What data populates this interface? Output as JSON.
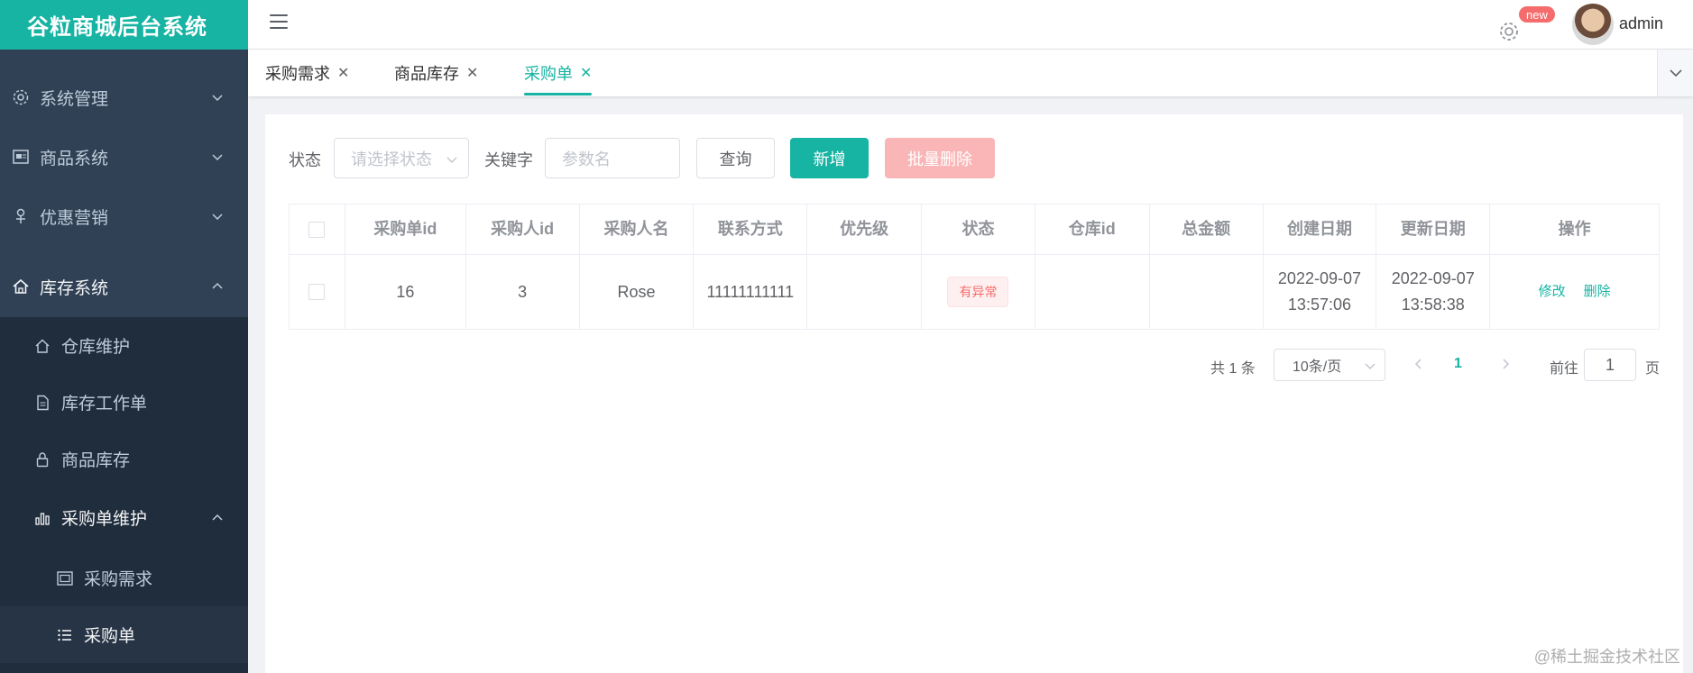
{
  "app": {
    "title": "谷粒商城后台系统"
  },
  "sidebar": {
    "items": [
      {
        "label": "系统管理",
        "icon": "gear-icon"
      },
      {
        "label": "商品系统",
        "icon": "goods-icon"
      },
      {
        "label": "优惠营销",
        "icon": "coupon-icon"
      },
      {
        "label": "库存系统",
        "icon": "home-icon"
      },
      {
        "label": "仓库维护",
        "icon": "house-icon"
      },
      {
        "label": "库存工作单",
        "icon": "document-icon"
      },
      {
        "label": "商品库存",
        "icon": "lock-icon"
      },
      {
        "label": "采购单维护",
        "icon": "bar-chart-icon"
      },
      {
        "label": "采购需求",
        "icon": "picture-icon"
      },
      {
        "label": "采购单",
        "icon": "list-icon"
      }
    ]
  },
  "header": {
    "badge": "new",
    "username": "admin"
  },
  "tabs": [
    {
      "label": "采购需求"
    },
    {
      "label": "商品库存"
    },
    {
      "label": "采购单"
    }
  ],
  "filters": {
    "status_label": "状态",
    "status_placeholder": "请选择状态",
    "keyword_label": "关键字",
    "keyword_placeholder": "参数名",
    "query_button": "查询",
    "add_button": "新增",
    "batch_delete_button": "批量删除"
  },
  "table": {
    "columns": [
      "采购单id",
      "采购人id",
      "采购人名",
      "联系方式",
      "优先级",
      "状态",
      "仓库id",
      "总金额",
      "创建日期",
      "更新日期",
      "操作"
    ],
    "rows": [
      {
        "id": "16",
        "assignee_id": "3",
        "assignee_name": "Rose",
        "phone": "11111111111",
        "priority": "",
        "status": "有异常",
        "ware_id": "",
        "amount": "",
        "create_date": "2022-09-07",
        "create_time": "13:57:06",
        "update_date": "2022-09-07",
        "update_time": "13:58:38",
        "edit_label": "修改",
        "delete_label": "删除"
      }
    ]
  },
  "pagination": {
    "total_text": "共 1 条",
    "page_size": "10条/页",
    "current_page": "1",
    "goto_label": "前往",
    "goto_value": "1",
    "page_suffix": "页"
  },
  "watermark": "@稀土掘金技术社区",
  "colors": {
    "accent": "#17b3a3",
    "sidebar_bg": "#304156",
    "danger": "#f56c6c"
  }
}
